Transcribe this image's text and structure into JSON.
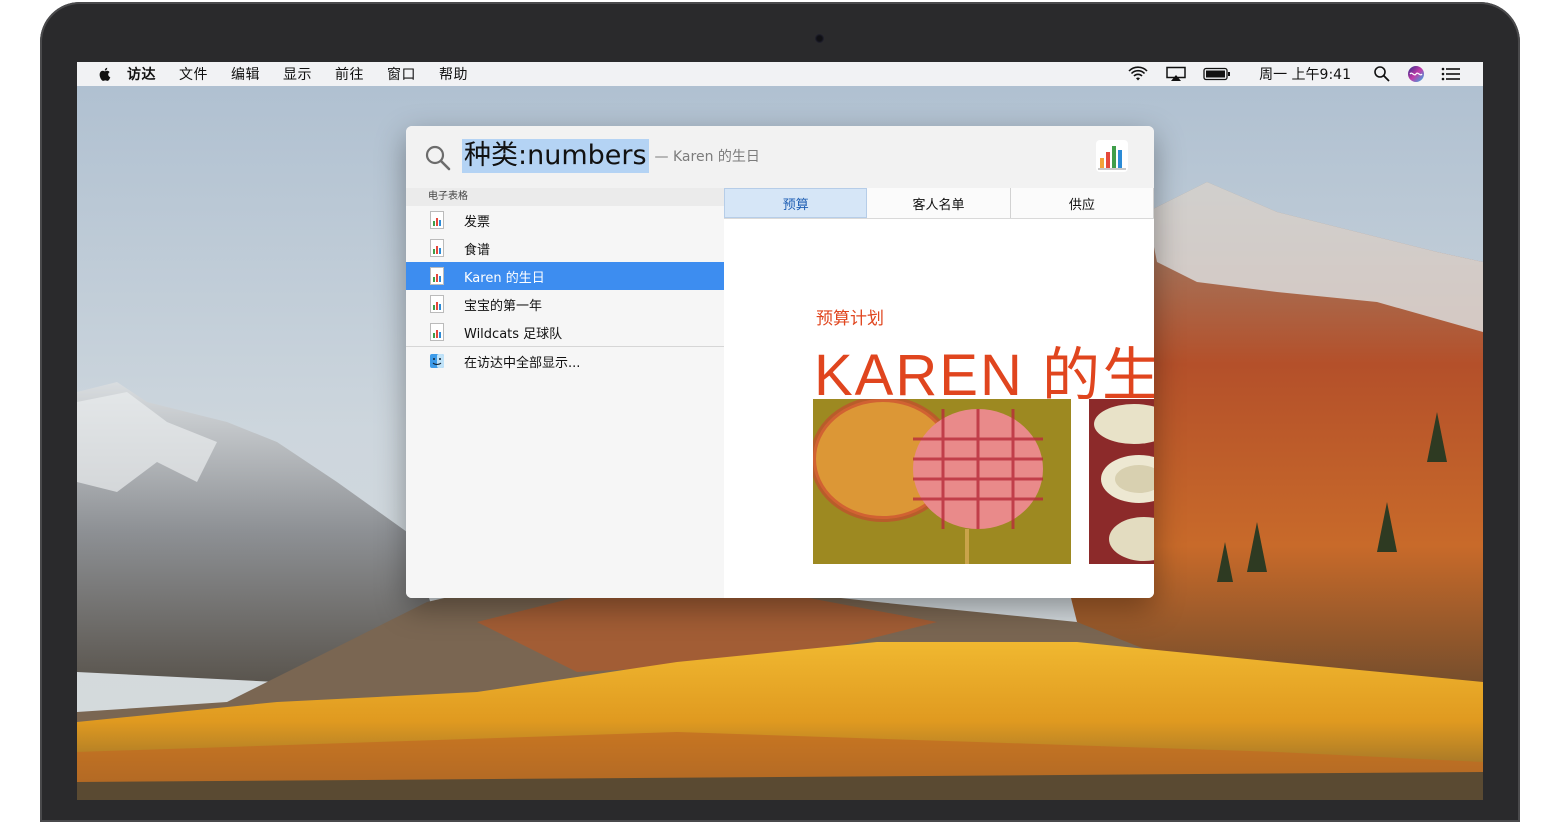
{
  "menubar": {
    "apple_icon": "apple-logo-icon",
    "items": [
      "访达",
      "文件",
      "编辑",
      "显示",
      "前往",
      "窗口",
      "帮助"
    ],
    "status_icons": [
      "wifi-icon",
      "airplay-icon",
      "battery-icon",
      "spotlight-search-icon",
      "siri-icon",
      "notification-center-icon"
    ],
    "clock": "周一 上午9:41"
  },
  "spotlight": {
    "query": "种类:numbers",
    "completion": "— Karen 的生日",
    "app_icon": "numbers-app-icon",
    "section_header": "电子表格",
    "results": [
      {
        "label": "发票",
        "icon": "numbers-document-icon",
        "selected": false
      },
      {
        "label": "食谱",
        "icon": "numbers-document-icon",
        "selected": false
      },
      {
        "label": "Karen 的生日",
        "icon": "numbers-document-icon",
        "selected": true
      },
      {
        "label": "宝宝的第一年",
        "icon": "numbers-document-icon",
        "selected": false
      },
      {
        "label": "Wildcats 足球队",
        "icon": "numbers-document-icon",
        "selected": false
      }
    ],
    "show_all": {
      "label": "在访达中全部显示...",
      "icon": "finder-icon"
    }
  },
  "preview": {
    "tabs": [
      {
        "label": "预算",
        "active": true
      },
      {
        "label": "客人名单",
        "active": false
      },
      {
        "label": "供应",
        "active": false
      }
    ],
    "subtitle": "预算计划",
    "title": "KAREN 的生",
    "accent_color": "#e0451e",
    "selection_color": "#3d8df0"
  }
}
